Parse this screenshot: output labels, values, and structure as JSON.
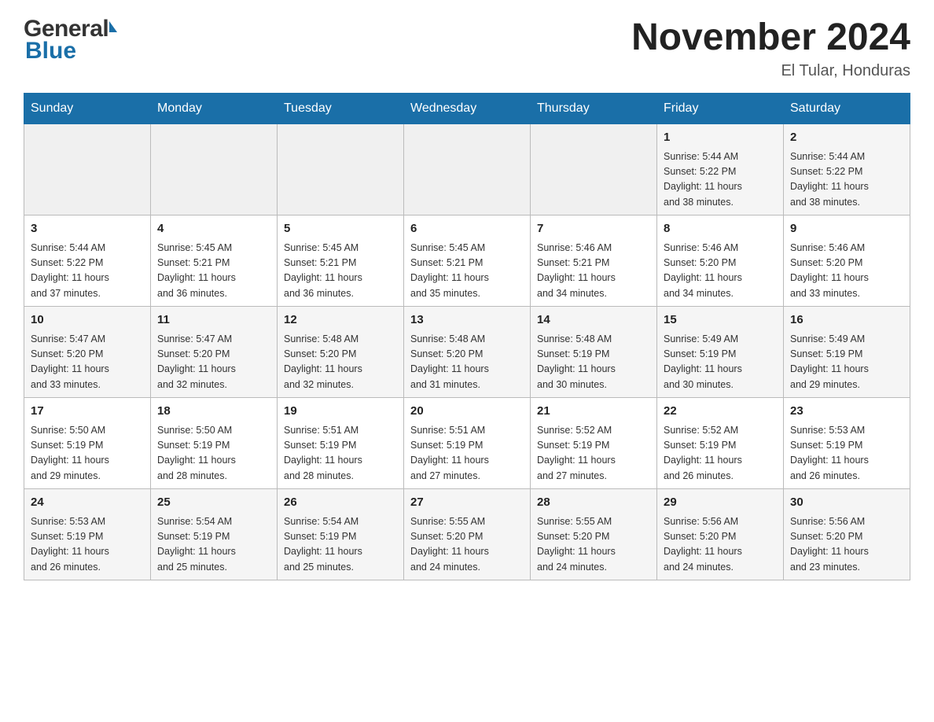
{
  "header": {
    "logo_general": "General",
    "logo_blue": "Blue",
    "title": "November 2024",
    "subtitle": "El Tular, Honduras"
  },
  "weekdays": [
    "Sunday",
    "Monday",
    "Tuesday",
    "Wednesday",
    "Thursday",
    "Friday",
    "Saturday"
  ],
  "weeks": [
    [
      {
        "day": "",
        "info": ""
      },
      {
        "day": "",
        "info": ""
      },
      {
        "day": "",
        "info": ""
      },
      {
        "day": "",
        "info": ""
      },
      {
        "day": "",
        "info": ""
      },
      {
        "day": "1",
        "info": "Sunrise: 5:44 AM\nSunset: 5:22 PM\nDaylight: 11 hours\nand 38 minutes."
      },
      {
        "day": "2",
        "info": "Sunrise: 5:44 AM\nSunset: 5:22 PM\nDaylight: 11 hours\nand 38 minutes."
      }
    ],
    [
      {
        "day": "3",
        "info": "Sunrise: 5:44 AM\nSunset: 5:22 PM\nDaylight: 11 hours\nand 37 minutes."
      },
      {
        "day": "4",
        "info": "Sunrise: 5:45 AM\nSunset: 5:21 PM\nDaylight: 11 hours\nand 36 minutes."
      },
      {
        "day": "5",
        "info": "Sunrise: 5:45 AM\nSunset: 5:21 PM\nDaylight: 11 hours\nand 36 minutes."
      },
      {
        "day": "6",
        "info": "Sunrise: 5:45 AM\nSunset: 5:21 PM\nDaylight: 11 hours\nand 35 minutes."
      },
      {
        "day": "7",
        "info": "Sunrise: 5:46 AM\nSunset: 5:21 PM\nDaylight: 11 hours\nand 34 minutes."
      },
      {
        "day": "8",
        "info": "Sunrise: 5:46 AM\nSunset: 5:20 PM\nDaylight: 11 hours\nand 34 minutes."
      },
      {
        "day": "9",
        "info": "Sunrise: 5:46 AM\nSunset: 5:20 PM\nDaylight: 11 hours\nand 33 minutes."
      }
    ],
    [
      {
        "day": "10",
        "info": "Sunrise: 5:47 AM\nSunset: 5:20 PM\nDaylight: 11 hours\nand 33 minutes."
      },
      {
        "day": "11",
        "info": "Sunrise: 5:47 AM\nSunset: 5:20 PM\nDaylight: 11 hours\nand 32 minutes."
      },
      {
        "day": "12",
        "info": "Sunrise: 5:48 AM\nSunset: 5:20 PM\nDaylight: 11 hours\nand 32 minutes."
      },
      {
        "day": "13",
        "info": "Sunrise: 5:48 AM\nSunset: 5:20 PM\nDaylight: 11 hours\nand 31 minutes."
      },
      {
        "day": "14",
        "info": "Sunrise: 5:48 AM\nSunset: 5:19 PM\nDaylight: 11 hours\nand 30 minutes."
      },
      {
        "day": "15",
        "info": "Sunrise: 5:49 AM\nSunset: 5:19 PM\nDaylight: 11 hours\nand 30 minutes."
      },
      {
        "day": "16",
        "info": "Sunrise: 5:49 AM\nSunset: 5:19 PM\nDaylight: 11 hours\nand 29 minutes."
      }
    ],
    [
      {
        "day": "17",
        "info": "Sunrise: 5:50 AM\nSunset: 5:19 PM\nDaylight: 11 hours\nand 29 minutes."
      },
      {
        "day": "18",
        "info": "Sunrise: 5:50 AM\nSunset: 5:19 PM\nDaylight: 11 hours\nand 28 minutes."
      },
      {
        "day": "19",
        "info": "Sunrise: 5:51 AM\nSunset: 5:19 PM\nDaylight: 11 hours\nand 28 minutes."
      },
      {
        "day": "20",
        "info": "Sunrise: 5:51 AM\nSunset: 5:19 PM\nDaylight: 11 hours\nand 27 minutes."
      },
      {
        "day": "21",
        "info": "Sunrise: 5:52 AM\nSunset: 5:19 PM\nDaylight: 11 hours\nand 27 minutes."
      },
      {
        "day": "22",
        "info": "Sunrise: 5:52 AM\nSunset: 5:19 PM\nDaylight: 11 hours\nand 26 minutes."
      },
      {
        "day": "23",
        "info": "Sunrise: 5:53 AM\nSunset: 5:19 PM\nDaylight: 11 hours\nand 26 minutes."
      }
    ],
    [
      {
        "day": "24",
        "info": "Sunrise: 5:53 AM\nSunset: 5:19 PM\nDaylight: 11 hours\nand 26 minutes."
      },
      {
        "day": "25",
        "info": "Sunrise: 5:54 AM\nSunset: 5:19 PM\nDaylight: 11 hours\nand 25 minutes."
      },
      {
        "day": "26",
        "info": "Sunrise: 5:54 AM\nSunset: 5:19 PM\nDaylight: 11 hours\nand 25 minutes."
      },
      {
        "day": "27",
        "info": "Sunrise: 5:55 AM\nSunset: 5:20 PM\nDaylight: 11 hours\nand 24 minutes."
      },
      {
        "day": "28",
        "info": "Sunrise: 5:55 AM\nSunset: 5:20 PM\nDaylight: 11 hours\nand 24 minutes."
      },
      {
        "day": "29",
        "info": "Sunrise: 5:56 AM\nSunset: 5:20 PM\nDaylight: 11 hours\nand 24 minutes."
      },
      {
        "day": "30",
        "info": "Sunrise: 5:56 AM\nSunset: 5:20 PM\nDaylight: 11 hours\nand 23 minutes."
      }
    ]
  ]
}
